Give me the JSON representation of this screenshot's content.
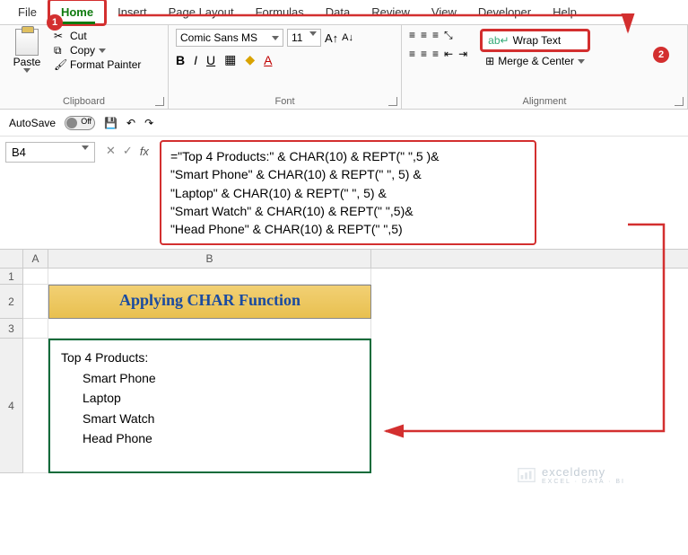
{
  "tabs": {
    "file": "File",
    "home": "Home",
    "insert": "Insert",
    "pageLayout": "Page Layout",
    "formulas": "Formulas",
    "data": "Data",
    "review": "Review",
    "view": "View",
    "developer": "Developer",
    "help": "Help"
  },
  "badges": {
    "one": "1",
    "two": "2"
  },
  "clipboard": {
    "paste": "Paste",
    "cut": "Cut",
    "copy": "Copy",
    "formatPainter": "Format Painter",
    "label": "Clipboard"
  },
  "font": {
    "name": "Comic Sans MS",
    "size": "11",
    "label": "Font",
    "bold": "B",
    "italic": "I",
    "underline": "U"
  },
  "alignment": {
    "wrapText": "Wrap Text",
    "mergeCenter": "Merge & Center",
    "label": "Alignment"
  },
  "quickbar": {
    "autosave": "AutoSave",
    "off": "Off"
  },
  "nameBox": "B4",
  "formulaLines": {
    "l1": "=\"Top 4 Products:\" & CHAR(10) & REPT(\" \",5 )&",
    "l2": " \"Smart Phone\" & CHAR(10) & REPT(\" \", 5) &",
    "l3": " \"Laptop\" & CHAR(10) & REPT(\" \", 5) &",
    "l4": "\"Smart Watch\" & CHAR(10) & REPT(\" \",5)&",
    "l5": "\"Head Phone\" & CHAR(10) & REPT(\" \",5)"
  },
  "columns": {
    "A": "A",
    "B": "B"
  },
  "rows": {
    "r1": "1",
    "r2": "2",
    "r3": "3",
    "r4": "4"
  },
  "titleCell": "Applying CHAR Function",
  "result": {
    "header": "Top 4 Products:",
    "i1": "Smart Phone",
    "i2": "Laptop",
    "i3": "Smart Watch",
    "i4": "Head Phone"
  },
  "watermark": {
    "brand": "exceldemy",
    "tag": "EXCEL · DATA · BI"
  }
}
